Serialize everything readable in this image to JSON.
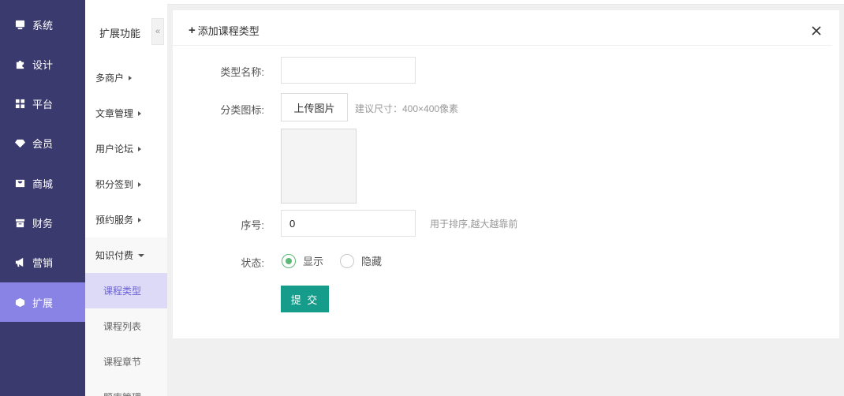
{
  "sidebar": {
    "items": [
      {
        "label": "系统",
        "icon": "monitor-icon"
      },
      {
        "label": "设计",
        "icon": "puzzle-icon"
      },
      {
        "label": "平台",
        "icon": "grid-icon"
      },
      {
        "label": "会员",
        "icon": "gem-icon"
      },
      {
        "label": "商城",
        "icon": "shop-icon"
      },
      {
        "label": "财务",
        "icon": "wallet-icon"
      },
      {
        "label": "营销",
        "icon": "megaphone-icon"
      },
      {
        "label": "扩展",
        "icon": "cube-icon"
      }
    ],
    "active_index": 7,
    "active_color": "#8a83e6",
    "background": "#3b3a6e"
  },
  "subbar": {
    "title": "扩展功能",
    "collapse": "«",
    "groups": [
      "多商户",
      "文章管理",
      "用户论坛",
      "积分签到",
      "预约服务",
      "知识付费"
    ],
    "children": [
      "课程类型",
      "课程列表",
      "课程章节",
      "题库管理"
    ]
  },
  "panel": {
    "title_icon": "+",
    "title": "添加课程类型",
    "close_icon": "close-icon"
  },
  "form": {
    "name_label": "类型名称:",
    "name_value": "",
    "icon_label": "分类图标:",
    "upload_label": "上传图片",
    "upload_hint": "建议尺寸：400×400像素",
    "order_label": "序号:",
    "order_value": "0",
    "order_hint": "用于排序,越大越靠前",
    "status_label": "状态:",
    "status_show": "显示",
    "status_hide": "隐藏",
    "status_checked": "显示",
    "submit_label": "提 交",
    "submit_color": "#169c8a"
  }
}
